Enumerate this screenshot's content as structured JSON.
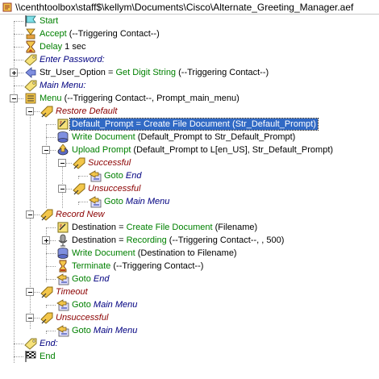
{
  "window": {
    "title": "\\\\centhtoolbox\\staff$\\kellym\\Documents\\Cisco\\Alternate_Greeting_Manager.aef"
  },
  "tree": {
    "start": "Start",
    "accept_kw": "Accept",
    "accept_args": " (--Triggering Contact--)",
    "delay_kw": "Delay",
    "delay_args": " 1 sec",
    "enter_password": "Enter Password:",
    "str_user_option_a": "Str_User_Option = ",
    "str_user_option_kw": "Get Digit String",
    "str_user_option_args": " (--Triggering Contact--)",
    "main_menu_label": "Main Menu:",
    "menu_kw": "Menu",
    "menu_args": " (--Triggering Contact--, Prompt_main_menu)",
    "restore_default": "Restore Default",
    "default_prompt_a": "Default_Prompt = ",
    "default_prompt_kw": "Create File Document",
    "default_prompt_args": " (Str_Default_Prompt)",
    "write_doc1_kw": "Write Document",
    "write_doc1_args": " (Default_Prompt to Str_Default_Prompt)",
    "upload_prompt_kw": "Upload Prompt",
    "upload_prompt_args": " (Default_Prompt to L[en_US], Str_Default_Prompt)",
    "successful": "Successful",
    "goto1_kw": "Goto",
    "goto1_target": " End",
    "unsuccessful1": "Unsuccessful",
    "goto2_kw": "Goto",
    "goto2_target": " Main Menu",
    "record_new": "Record New",
    "destination1_a": "Destination = ",
    "destination1_kw": "Create File Document",
    "destination1_args": " (Filename)",
    "destination2_a": "Destination = ",
    "destination2_kw": "Recording",
    "destination2_args": " (--Triggering Contact--, , 500)",
    "write_doc2_kw": "Write Document",
    "write_doc2_args": " (Destination to Filename)",
    "terminate_kw": "Terminate",
    "terminate_args": " (--Triggering Contact--)",
    "goto3_kw": "Goto",
    "goto3_target": " End",
    "timeout": "Timeout",
    "goto4_kw": "Goto",
    "goto4_target": " Main Menu",
    "unsuccessful2": "Unsuccessful",
    "goto5_kw": "Goto",
    "goto5_target": " Main Menu",
    "end_label": "End:",
    "end": "End"
  },
  "colors": {
    "step_keyword": "#008000",
    "label_text": "#000080",
    "branch_text": "#8b0000",
    "selection": "#316ac5"
  },
  "icons": {
    "title": "script-file-icon",
    "start": "start-flag-icon",
    "accept": "accept-icon",
    "delay": "hourglass-icon",
    "label": "label-tag-icon",
    "get_digit": "get-digit-icon",
    "menu": "menu-icon",
    "branch": "branch-icon",
    "set": "set-variable-icon",
    "write": "write-document-icon",
    "upload": "upload-prompt-icon",
    "goto": "goto-icon",
    "recording": "recording-icon",
    "terminate": "terminate-icon",
    "end": "end-flag-icon"
  }
}
